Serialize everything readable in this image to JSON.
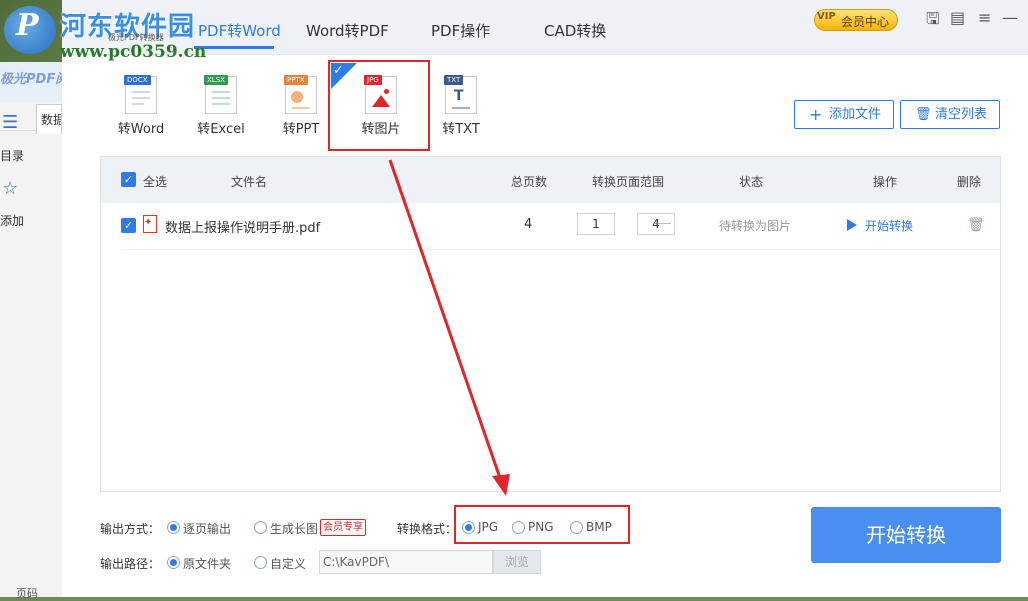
{
  "background_window": {
    "title": "极光PDF阅",
    "doc_tab": "数据",
    "side_items": [
      {
        "label": "目录",
        "icon": "list-icon"
      },
      {
        "label": "添加",
        "icon": "star-icon"
      }
    ],
    "page_label": "页码"
  },
  "watermark": {
    "logo_letter": "P",
    "title": "河东软件园",
    "small_text": "极光PDF转换器",
    "url": "www.pc0359.cn"
  },
  "header": {
    "tabs": [
      {
        "label": "PDF转Word",
        "active": true
      },
      {
        "label": "Word转PDF",
        "active": false
      },
      {
        "label": "PDF操作",
        "active": false
      },
      {
        "label": "CAD转换",
        "active": false
      }
    ],
    "vip_label": "会员中心",
    "vip_crown": "VIP",
    "window_icons": [
      "monitor-icon",
      "message-icon",
      "menu-icon",
      "minimize-icon",
      "close-icon"
    ]
  },
  "formats": [
    {
      "label": "转Word",
      "tag": "DOCX",
      "color": "#2f6fcf",
      "selected": false
    },
    {
      "label": "转Excel",
      "tag": "XLSX",
      "color": "#2e9b4f",
      "selected": false
    },
    {
      "label": "转PPT",
      "tag": "PPTX",
      "color": "#e8833a",
      "selected": false
    },
    {
      "label": "转图片",
      "tag": "JPG",
      "color": "#e0262b",
      "selected": true
    },
    {
      "label": "转TXT",
      "tag": "TXT",
      "color": "#3b5a8a",
      "selected": false
    }
  ],
  "actions": {
    "add_file": "添加文件",
    "clear_list": "清空列表"
  },
  "table": {
    "headers": {
      "select_all": "全选",
      "file_name": "文件名",
      "total_pages": "总页数",
      "page_range": "转换页面范围",
      "status": "状态",
      "operation": "操作",
      "delete": "删除"
    },
    "rows": [
      {
        "file_name": "数据上报操作说明手册.pdf",
        "total_pages": "4",
        "range_start": "1",
        "range_end": "4",
        "status": "待转换为图片",
        "operation": "开始转换"
      }
    ]
  },
  "options": {
    "output_mode_label": "输出方式：",
    "output_modes": [
      {
        "label": "逐页输出",
        "selected": true
      },
      {
        "label": "生成长图",
        "selected": false
      }
    ],
    "vip_only_badge": "会员专享",
    "format_label": "转换格式：",
    "formats": [
      {
        "label": "JPG",
        "selected": true
      },
      {
        "label": "PNG",
        "selected": false
      },
      {
        "label": "BMP",
        "selected": false
      }
    ],
    "output_path_label": "输出路径：",
    "path_modes": [
      {
        "label": "原文件夹",
        "selected": true
      },
      {
        "label": "自定义",
        "selected": false
      }
    ],
    "path_value": "C:\\KavPDF\\",
    "browse": "浏览"
  },
  "start_convert": "开始转换",
  "colors": {
    "accent": "#2f7bea",
    "annotation_red": "#e0262b",
    "primary_button": "#4a8ef0"
  }
}
